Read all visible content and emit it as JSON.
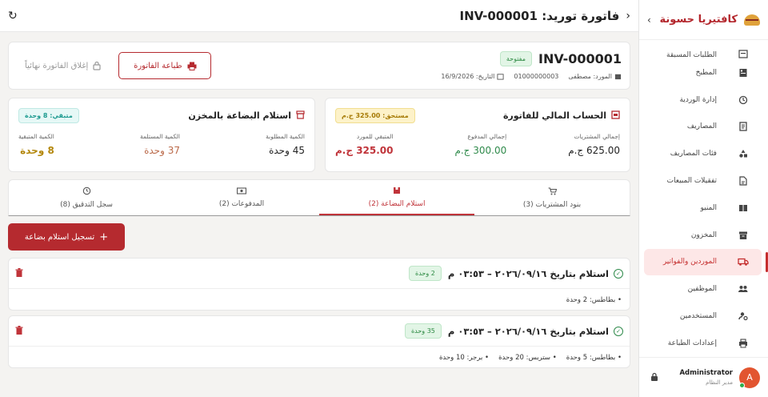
{
  "sidebar": {
    "brand": "كافتيريا حسونة",
    "collapse": "›",
    "items": [
      {
        "label": "الطلبات المسبقة",
        "icon": "calendar-icon"
      },
      {
        "label": "المطبخ",
        "icon": "kitchen-icon"
      },
      {
        "label": "إدارة الوردية",
        "icon": "shift-icon"
      },
      {
        "label": "المصاريف",
        "icon": "receipt-icon"
      },
      {
        "label": "فئات المصاريف",
        "icon": "category-icon"
      },
      {
        "label": "تفقيلات المبيعات",
        "icon": "report-icon"
      },
      {
        "label": "المنيو",
        "icon": "menu-book-icon"
      },
      {
        "label": "المخزون",
        "icon": "inventory-icon"
      },
      {
        "label": "الموردين والفواتير",
        "icon": "truck-icon"
      },
      {
        "label": "الموظفين",
        "icon": "people-icon"
      },
      {
        "label": "المستخدمين",
        "icon": "user-settings-icon"
      },
      {
        "label": "إعدادات الطباعة",
        "icon": "printer-icon"
      }
    ],
    "active_index": 8,
    "user": {
      "initial": "A",
      "name": "Administrator",
      "role": "مدير النظام"
    }
  },
  "topbar": {
    "title": "فاتورة توريد: INV-000001"
  },
  "invoice": {
    "number": "INV-000001",
    "status": "مفتوحة",
    "supplier": "المورد: مصطفى",
    "phone": "01000000003",
    "date": "التاريخ: 16/9/2026",
    "print_label": "طباعة الفاتورة",
    "close_label": "إغلاق الفاتورة نهائياً"
  },
  "financial": {
    "title": "الحساب المالي للفاتورة",
    "badge": "مستحق: 325.00 ج.م",
    "stats": [
      {
        "label": "إجمالي المشتريات",
        "value": "625.00 ج.م"
      },
      {
        "label": "إجمالي المدفوع",
        "value": "300.00 ج.م"
      },
      {
        "label": "المتبقي للمورد",
        "value": "325.00 ج.م"
      }
    ]
  },
  "stock": {
    "title": "استلام البضاعة بالمخزن",
    "badge": "متبقي: 8 وحدة",
    "stats": [
      {
        "label": "الكمية المطلوبة",
        "value": "45 وحدة"
      },
      {
        "label": "الكمية المستلمة",
        "value": "37 وحدة"
      },
      {
        "label": "الكمية المتبقية",
        "value": "8 وحدة"
      }
    ]
  },
  "tabs": [
    {
      "label": "بنود المشتريات (3)",
      "icon": "cart-icon"
    },
    {
      "label": "استلام البضاعة (2)",
      "icon": "box-icon"
    },
    {
      "label": "المدفوعات (2)",
      "icon": "cash-icon"
    },
    {
      "label": "سجل التدقيق (8)",
      "icon": "history-icon"
    }
  ],
  "active_tab": 1,
  "add_receipt_label": "تسجيل استلام بضاعة",
  "receipts": [
    {
      "title": "استلام بتاريخ ٢٠٢٦/٠٩/١٦ – ٠٣:٥٣ م",
      "badge": "2 وحدة",
      "items": [
        "بطاطس: 2 وحدة"
      ]
    },
    {
      "title": "استلام بتاريخ ٢٠٢٦/٠٩/١٦ – ٠٣:٥٣ م",
      "badge": "35 وحدة",
      "items": [
        "بطاطس: 5 وحدة",
        "ستربس: 20 وحدة",
        "برجر: 10 وحدة"
      ]
    }
  ],
  "colors": {
    "primary": "#b52a2f",
    "success": "#2f8a4b",
    "warning": "#b3870b"
  }
}
